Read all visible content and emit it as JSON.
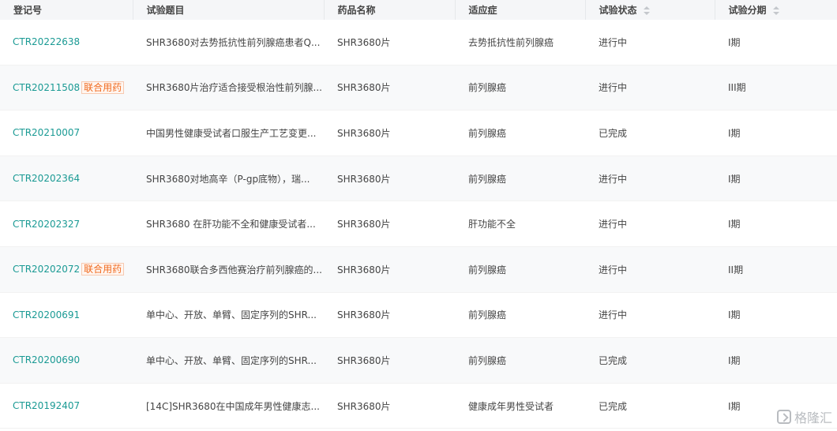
{
  "table": {
    "headers": {
      "reg_no": "登记号",
      "title": "试验题目",
      "drug": "药品名称",
      "indication": "适应症",
      "status": "试验状态",
      "phase": "试验分期"
    },
    "rows": [
      {
        "reg_no": "CTR20222638",
        "tag": "",
        "title": "SHR3680对去势抵抗性前列腺癌患者Q...",
        "drug": "SHR3680片",
        "indication": "去势抵抗性前列腺癌",
        "status": "进行中",
        "phase": "I期"
      },
      {
        "reg_no": "CTR20211508",
        "tag": "联合用药",
        "title": "SHR3680片治疗适合接受根治性前列腺...",
        "drug": "SHR3680片",
        "indication": "前列腺癌",
        "status": "进行中",
        "phase": "III期"
      },
      {
        "reg_no": "CTR20210007",
        "tag": "",
        "title": "中国男性健康受试者口服生产工艺变更...",
        "drug": "SHR3680片",
        "indication": "前列腺癌",
        "status": "已完成",
        "phase": "I期"
      },
      {
        "reg_no": "CTR20202364",
        "tag": "",
        "title": "SHR3680对地高辛（P-gp底物），瑞...",
        "drug": "SHR3680片",
        "indication": "前列腺癌",
        "status": "进行中",
        "phase": "I期"
      },
      {
        "reg_no": "CTR20202327",
        "tag": "",
        "title": "SHR3680 在肝功能不全和健康受试者...",
        "drug": "SHR3680片",
        "indication": "肝功能不全",
        "status": "进行中",
        "phase": "I期"
      },
      {
        "reg_no": "CTR20202072",
        "tag": "联合用药",
        "title": "SHR3680联合多西他赛治疗前列腺癌的...",
        "drug": "SHR3680片",
        "indication": "前列腺癌",
        "status": "进行中",
        "phase": "II期"
      },
      {
        "reg_no": "CTR20200691",
        "tag": "",
        "title": "单中心、开放、单臂、固定序列的SHR...",
        "drug": "SHR3680片",
        "indication": "前列腺癌",
        "status": "进行中",
        "phase": "I期"
      },
      {
        "reg_no": "CTR20200690",
        "tag": "",
        "title": "单中心、开放、单臂、固定序列的SHR...",
        "drug": "SHR3680片",
        "indication": "前列腺癌",
        "status": "已完成",
        "phase": "I期"
      },
      {
        "reg_no": "CTR20192407",
        "tag": "",
        "title": "[14C]SHR3680在中国成年男性健康志...",
        "drug": "SHR3680片",
        "indication": "健康成年男性受试者",
        "status": "已完成",
        "phase": "I期"
      }
    ]
  },
  "watermark": {
    "text": "格隆汇"
  },
  "colors": {
    "link": "#1a9a94",
    "tag_text": "#f06a1e",
    "tag_border": "#f7c9b0",
    "header_bg": "#f5f6f8",
    "stripe_bg": "#f8f9fa"
  },
  "icons": {
    "sort": "sort-icon",
    "watermark_logo": "gelonghui-logo-icon"
  }
}
